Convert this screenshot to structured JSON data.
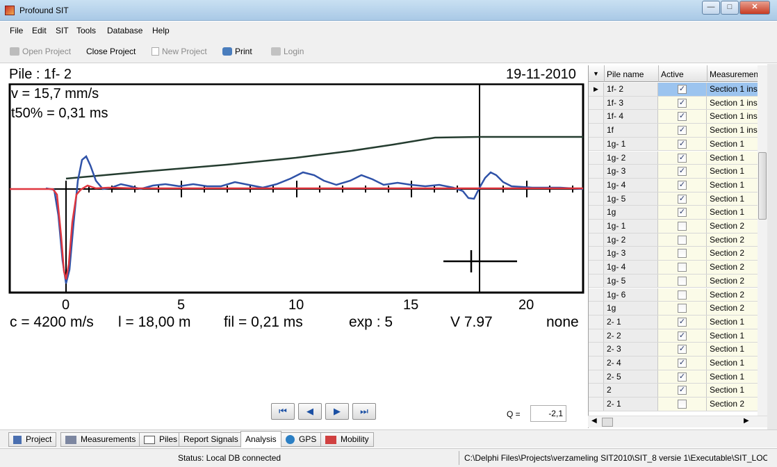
{
  "window": {
    "title": "Profound SIT"
  },
  "menu": [
    "File",
    "Edit",
    "SIT",
    "Tools",
    "Database",
    "Help"
  ],
  "toolbar": {
    "open_project": "Open Project",
    "close_project": "Close Project",
    "new_project": "New Project",
    "print": "Print",
    "login": "Login"
  },
  "graph": {
    "pile_title": "Pile : 1f- 2",
    "date": "19-11-2010",
    "velocity": "v    = 15,7 mm/s",
    "t50": "t50% = 0,31 ms",
    "x_ticks": [
      "0",
      "5",
      "10",
      "15",
      "20"
    ],
    "params": {
      "c": "c = 4200 m/s",
      "l": "l = 18,00 m",
      "fil": "fil = 0,21 ms",
      "exp": "exp : 5",
      "version": "V 7.97",
      "mode": "none"
    },
    "colors": {
      "velocity_signal": "#2f52a8",
      "filtered_signal": "#e0373f",
      "amplification": "#243c2f"
    }
  },
  "navigation": {
    "first": "⏮",
    "prev": "◀",
    "next": "▶",
    "last": "⏭"
  },
  "q": {
    "label": "Q =",
    "value": "-2,1"
  },
  "piles_table": {
    "headers": [
      "Pile name",
      "Active",
      "Measuremen"
    ],
    "rows": [
      {
        "name": "1f- 2",
        "active": true,
        "measurement": "Section 1 ins"
      },
      {
        "name": "1f- 3",
        "active": true,
        "measurement": "Section 1 ins"
      },
      {
        "name": "1f- 4",
        "active": true,
        "measurement": "Section 1 ins"
      },
      {
        "name": "1f",
        "active": true,
        "measurement": "Section 1 ins"
      },
      {
        "name": "1g- 1",
        "active": true,
        "measurement": "Section 1"
      },
      {
        "name": "1g- 2",
        "active": true,
        "measurement": "Section 1"
      },
      {
        "name": "1g- 3",
        "active": true,
        "measurement": "Section 1"
      },
      {
        "name": "1g- 4",
        "active": true,
        "measurement": "Section 1"
      },
      {
        "name": "1g- 5",
        "active": true,
        "measurement": "Section 1"
      },
      {
        "name": "1g",
        "active": true,
        "measurement": "Section 1"
      },
      {
        "name": "1g- 1",
        "active": false,
        "measurement": "Section 2"
      },
      {
        "name": "1g- 2",
        "active": false,
        "measurement": "Section 2"
      },
      {
        "name": "1g- 3",
        "active": false,
        "measurement": "Section 2"
      },
      {
        "name": "1g- 4",
        "active": false,
        "measurement": "Section 2"
      },
      {
        "name": "1g- 5",
        "active": false,
        "measurement": "Section 2"
      },
      {
        "name": "1g- 6",
        "active": false,
        "measurement": "Section 2"
      },
      {
        "name": "1g",
        "active": false,
        "measurement": "Section 2"
      },
      {
        "name": "2- 1",
        "active": true,
        "measurement": "Section 1"
      },
      {
        "name": "2- 2",
        "active": true,
        "measurement": "Section 1"
      },
      {
        "name": "2- 3",
        "active": true,
        "measurement": "Section 1"
      },
      {
        "name": "2- 4",
        "active": true,
        "measurement": "Section 1"
      },
      {
        "name": "2- 5",
        "active": true,
        "measurement": "Section 1"
      },
      {
        "name": "2",
        "active": true,
        "measurement": "Section 1"
      },
      {
        "name": "2- 1",
        "active": false,
        "measurement": "Section 2"
      }
    ]
  },
  "tabs": [
    "Project",
    "Measurements",
    "Piles",
    "Report Signals",
    "Analysis",
    "GPS",
    "Mobility"
  ],
  "active_tab": "Analysis",
  "status": {
    "db": "Status: Local DB connected",
    "path": "C:\\Delphi Files\\Projects\\verzameling SIT2010\\SIT_8 versie 1\\Executable\\SIT_LOC"
  }
}
